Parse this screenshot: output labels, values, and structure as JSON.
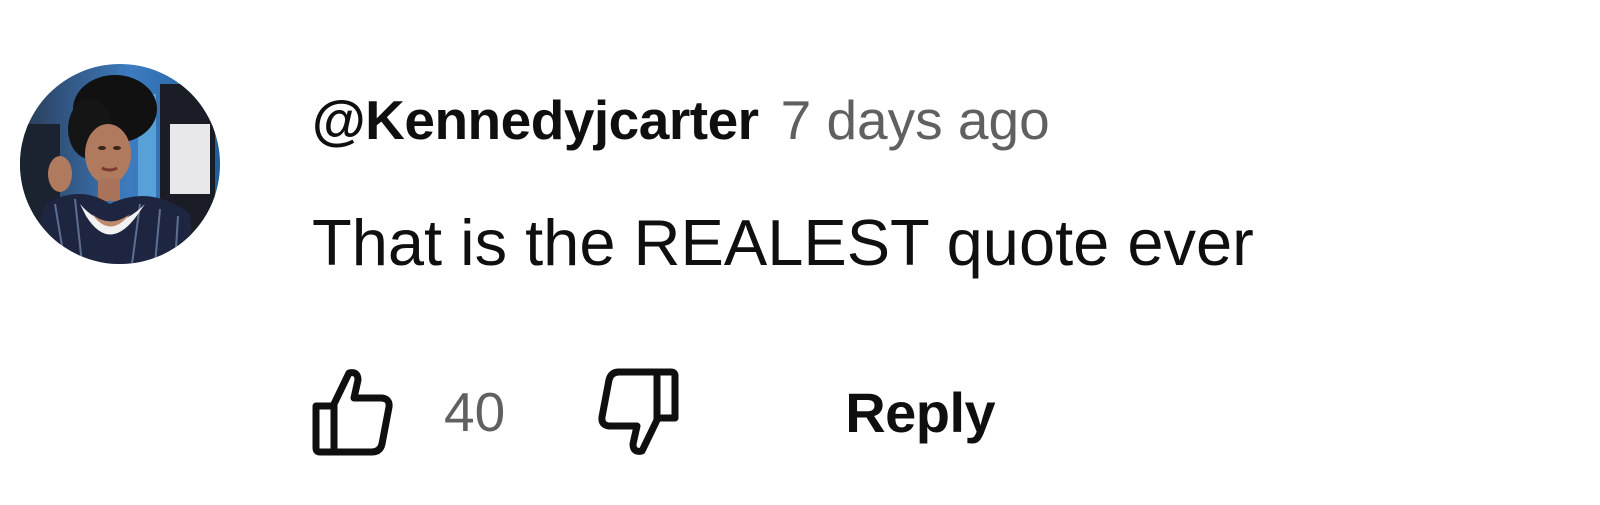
{
  "comment": {
    "author": "@Kennedyjcarter",
    "timestamp": "7 days ago",
    "text": "That is the REALEST quote ever",
    "like_count": "40",
    "reply_label": "Reply"
  },
  "icons": {
    "like": "thumbs-up-icon",
    "dislike": "thumbs-down-icon",
    "avatar": "user-avatar"
  },
  "colors": {
    "primary_text": "#0f0f0f",
    "secondary_text": "#606060",
    "background": "#ffffff"
  }
}
